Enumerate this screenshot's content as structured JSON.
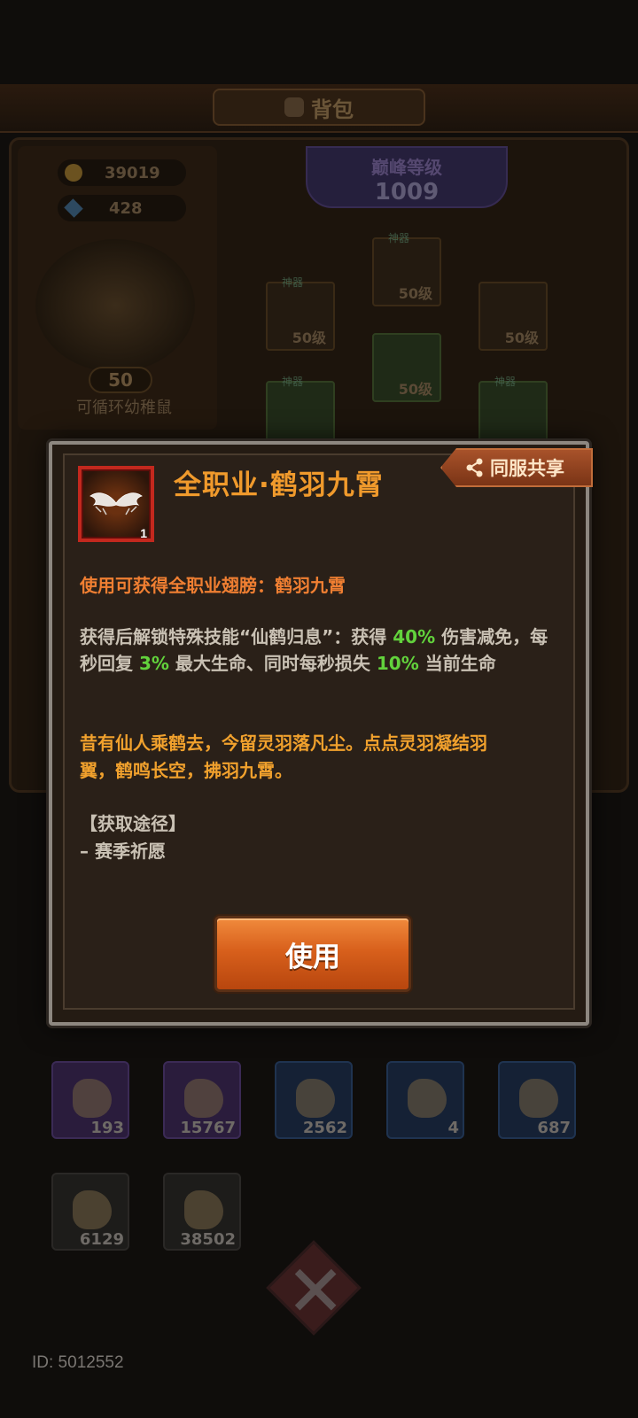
{
  "background": {
    "title": "背包",
    "gold": "39019",
    "gems": "428",
    "hero_level": "50",
    "hero_name": "可循环幼稚鼠",
    "peak_label": "巅峰等级",
    "peak_value": "1009",
    "equip_tag": "神器",
    "equip_level": "50级",
    "items_row1": [
      "193",
      "15767",
      "2562",
      "4",
      "687"
    ],
    "items_row2": [
      "6129",
      "38502"
    ]
  },
  "dialog": {
    "item_title": "全职业·鹤羽九霄",
    "item_count": "1",
    "share_label": "同服共享",
    "desc_orange": "使用可获得全职业翅膀：鹤羽九霄",
    "desc": {
      "p1": "获得后解锁特殊技能“仙鹤归息”：获得 ",
      "v1": "40%",
      "p2": " 伤害减免，每秒回复 ",
      "v2": "3%",
      "p3": " 最大生命、同时每秒损失 ",
      "v3": "10%",
      "p4": " 当前生命"
    },
    "lore_line1": "昔有仙人乘鹤去，今留灵羽落凡尘。点点灵羽凝结羽",
    "lore_line2": "翼，鹤鸣长空，拂羽九霄。",
    "source_heading": "【获取途径】",
    "source_value": "– 赛季祈愿",
    "use_label": "使用"
  },
  "footer": {
    "uid": "ID: 5012552"
  },
  "colors": {
    "title_orange": "#f09a2c",
    "highlight_green": "#62d23c",
    "lore_gold": "#f1a12d",
    "frame_red": "#c2281e"
  }
}
